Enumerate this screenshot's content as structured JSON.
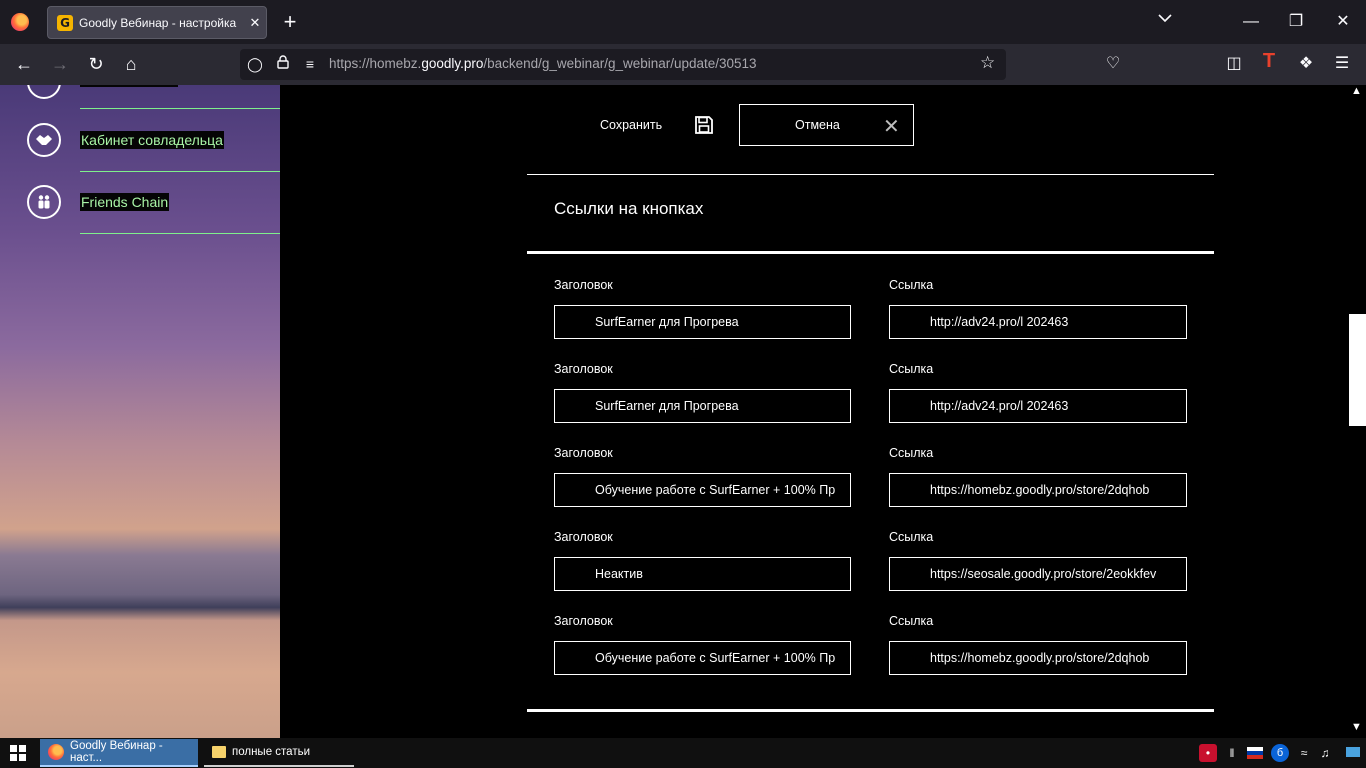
{
  "browser": {
    "tab_title": "Goodly Вебинар - настройка",
    "tab_favicon": "G",
    "url_prefix": "https://homebz.",
    "url_domain": "goodly.pro",
    "url_path": "/backend/g_webinar/g_webinar/update/30513",
    "new_tab": "+",
    "close_tab": "✕"
  },
  "sidebar": {
    "items": [
      {
        "label": "Кабинет совладельца",
        "icon": "handshake-icon"
      },
      {
        "label": "Friends Chain",
        "icon": "people-icon"
      }
    ]
  },
  "toolbar": {
    "save_label": "Сохранить",
    "cancel_label": "Отмена"
  },
  "section": {
    "title": "Ссылки на кнопках"
  },
  "buttons_links": {
    "title_label": "Заголовок",
    "link_label": "Ссылка",
    "rows": [
      {
        "title": "SurfEarner для Прогрева",
        "link": "http://adv24.pro/l 202463"
      },
      {
        "title": "SurfEarner для Прогрева",
        "link": "http://adv24.pro/l 202463"
      },
      {
        "title": "Обучение работе с SurfEarner + 100% Пр",
        "link": "https://homebz.goodly.pro/store/2dqhob"
      },
      {
        "title": "Неактив",
        "link": "https://seosale.goodly.pro/store/2eokkfev"
      },
      {
        "title": "Обучение работе с SurfEarner + 100% Пр",
        "link": "https://homebz.goodly.pro/store/2dqhob"
      }
    ]
  },
  "taskbar": {
    "items": [
      {
        "label": "Goodly Вебинар - наст...",
        "icon": "firefox-icon"
      },
      {
        "label": "полные статьи",
        "icon": "folder-icon"
      }
    ]
  }
}
